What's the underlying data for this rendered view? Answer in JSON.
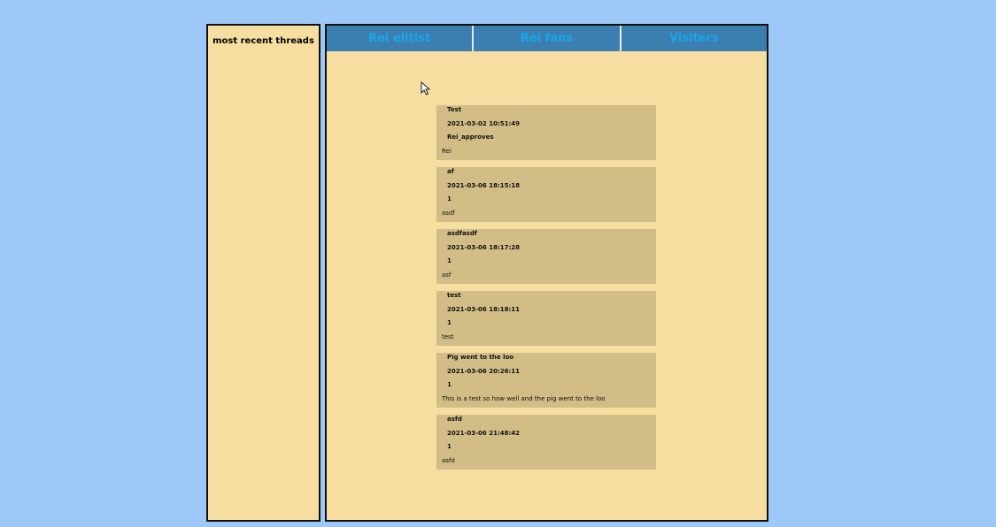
{
  "sidebar": {
    "title": "most recent threads"
  },
  "nav": {
    "tabs": [
      {
        "label": "Rei elitist"
      },
      {
        "label": "Rei fans"
      },
      {
        "label": "Visiters"
      }
    ]
  },
  "threads": [
    {
      "title": "Test",
      "date": "2021-03-02 10:51:49",
      "user": "Rei_approves",
      "body": "Rei"
    },
    {
      "title": "af",
      "date": "2021-03-06 18:15:18",
      "user": "1",
      "body": "asdf"
    },
    {
      "title": "asdfasdf",
      "date": "2021-03-06 18:17:28",
      "user": "1",
      "body": "asf"
    },
    {
      "title": "test",
      "date": "2021-03-06 18:18:11",
      "user": "1",
      "body": "test"
    },
    {
      "title": "Pig went to the loo",
      "date": "2021-03-06 20:26:11",
      "user": "1",
      "body": "This is a test so how well and the pig went to the loo"
    },
    {
      "title": "asfd",
      "date": "2021-03-06 21:48:42",
      "user": "1",
      "body": "asfd"
    }
  ],
  "colors": {
    "page_background": "#9dc8f7",
    "panel_background": "#f5de9f",
    "nav_background": "#3b7fb1",
    "nav_text": "#1aa4ea",
    "thread_background": "#d2bd87"
  },
  "icons": {
    "cursor": "mouse-pointer-icon"
  }
}
